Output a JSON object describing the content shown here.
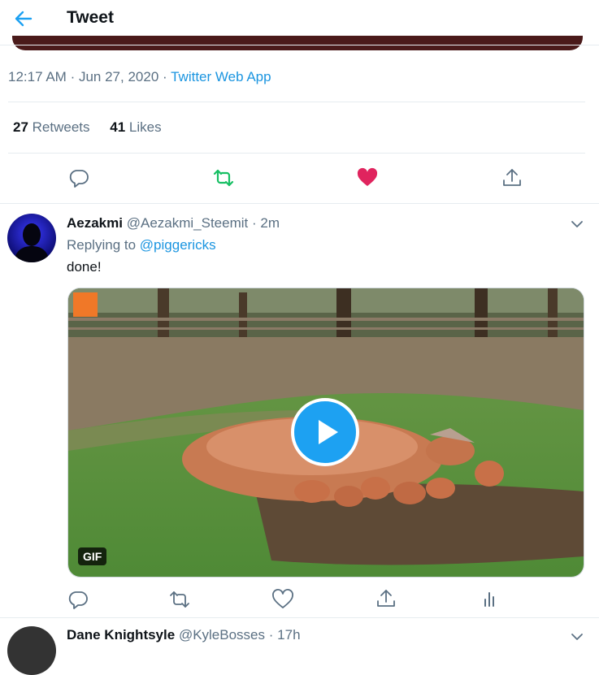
{
  "header": {
    "title": "Tweet",
    "back_icon": "arrow-left-icon",
    "accent": "#1da1f2"
  },
  "tweet_meta": {
    "time": "12:17 AM",
    "date": "Jun 27, 2020",
    "dot": "·",
    "source": "Twitter Web App"
  },
  "stats": {
    "retweets_count": "27",
    "retweets_label": "Retweets",
    "likes_count": "41",
    "likes_label": "Likes"
  },
  "actions": {
    "reply_icon": "reply-icon",
    "retweet_icon": "retweet-icon",
    "like_icon": "heart-icon",
    "share_icon": "share-icon",
    "retweet_color": "#17bf63",
    "like_color": "#e0245e"
  },
  "reply": {
    "name": "Aezakmi",
    "handle": "@Aezakmi_Steemit",
    "dot": "·",
    "time": "2m",
    "replying_to_label": "Replying to",
    "replying_to": "@piggericks",
    "text": "done!",
    "media_badge": "GIF"
  },
  "next_reply": {
    "name": "Dane Knightsyle",
    "handle": "@KyleBosses",
    "dot": "·",
    "time": "17h"
  }
}
